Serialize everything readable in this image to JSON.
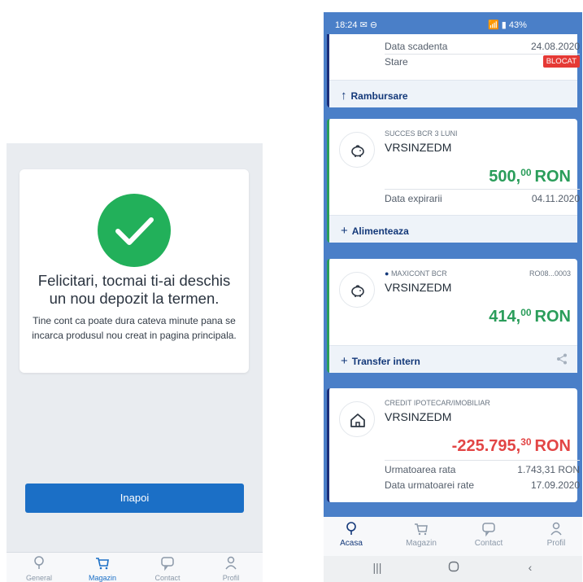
{
  "left": {
    "success_line1": "Felicitari, tocmai ti-ai deschis",
    "success_line2": "un nou depozit la termen.",
    "success_note": "Tine cont ca poate dura cateva minute pana se incarca produsul nou creat in pagina principala.",
    "back_button": "Inapoi",
    "nav": [
      {
        "label": "General",
        "icon": "bulb-icon"
      },
      {
        "label": "Magazin",
        "icon": "cart-icon",
        "active": true
      },
      {
        "label": "Contact",
        "icon": "chat-icon"
      },
      {
        "label": "Profil",
        "icon": "person-icon"
      }
    ]
  },
  "right": {
    "status": {
      "time": "18:24",
      "battery": "43%"
    },
    "card1": {
      "rows": [
        {
          "label": "Data scadenta",
          "value": "24.08.2020"
        },
        {
          "label": "Stare",
          "badge": "BLOCAT"
        }
      ],
      "footer": "Rambursare"
    },
    "card2": {
      "product": "SUCCES BCR 3 LUNI",
      "name": "VRSINZEDM",
      "amount_int": "500,",
      "amount_dec": "00",
      "currency": "RON",
      "expiry_label": "Data expirarii",
      "expiry_value": "04.11.2020",
      "footer": "Alimenteaza"
    },
    "card3": {
      "product": "MAXICONT BCR",
      "iban": "RO08...0003",
      "name": "VRSINZEDM",
      "amount_int": "414,",
      "amount_dec": "00",
      "currency": "RON",
      "footer": "Transfer intern"
    },
    "card4": {
      "product": "CREDIT IPOTECAR/IMOBILIAR",
      "name": "VRSINZEDM",
      "amount_int": "-225.795,",
      "amount_dec": "30",
      "currency": "RON",
      "rows": [
        {
          "label": "Urmatoarea rata",
          "value": "1.743,31 RON"
        },
        {
          "label": "Data urmatoarei rate",
          "value": "17.09.2020"
        }
      ]
    },
    "nav": [
      {
        "label": "Acasa",
        "icon": "bulb-icon",
        "active": true
      },
      {
        "label": "Magazin",
        "icon": "cart-icon"
      },
      {
        "label": "Contact",
        "icon": "chat-icon"
      },
      {
        "label": "Profil",
        "icon": "person-icon"
      }
    ]
  },
  "colors": {
    "accent": "#1b6fc6",
    "success": "#22b05a",
    "positive": "#2a9d5a",
    "negative": "#e24545",
    "blocked": "#e53935",
    "phone_bg": "#4a7fc8"
  }
}
